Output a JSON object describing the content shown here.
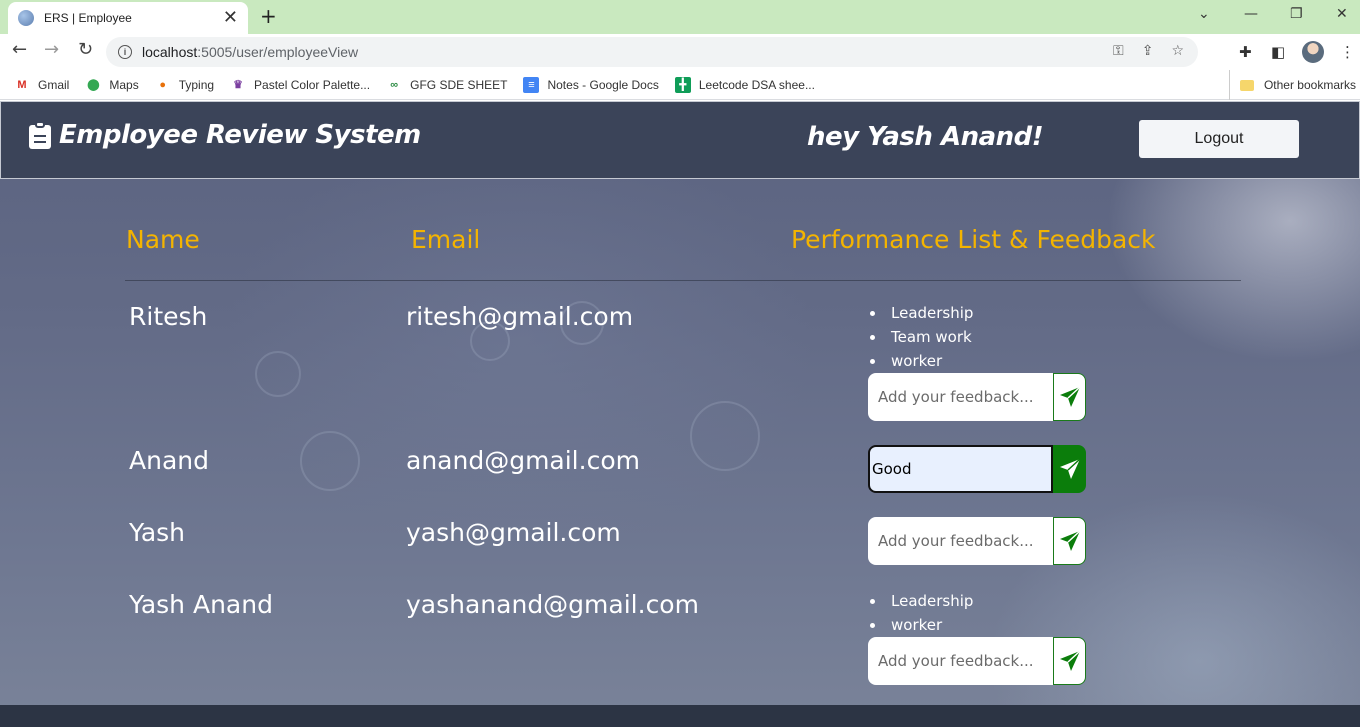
{
  "browser": {
    "tab_title": "ERS | Employee",
    "tab_close": "✕",
    "new_tab": "+",
    "url_host": "localhost",
    "url_rest": ":5005/user/employeeView",
    "bookmarks": [
      {
        "label": "Gmail",
        "icon": "gmail-icon",
        "color": "#d93025"
      },
      {
        "label": "Maps",
        "icon": "maps-icon",
        "color": "#34a853"
      },
      {
        "label": "Typing",
        "icon": "typing-icon",
        "color": "#e8710a"
      },
      {
        "label": "Pastel Color Palette...",
        "icon": "palette-icon",
        "color": "#7b3fa0"
      },
      {
        "label": "GFG SDE SHEET",
        "icon": "gfg-icon",
        "color": "#2f8d46"
      },
      {
        "label": "Notes - Google Docs",
        "icon": "docs-icon",
        "color": "#4285f4"
      },
      {
        "label": "Leetcode DSA shee...",
        "icon": "sheets-icon",
        "color": "#0f9d58"
      }
    ],
    "other_bookmarks": "Other bookmarks"
  },
  "navbar": {
    "brand": "Employee Review System",
    "greeting": "hey Yash Anand!",
    "logout_label": "Logout"
  },
  "table": {
    "headers": {
      "name": "Name",
      "email": "Email",
      "performance": "Performance List & Feedback"
    },
    "rows": [
      {
        "name": "Ritesh",
        "email": "ritesh@gmail.com",
        "performance": [
          "Leadership",
          "Team work",
          "worker"
        ],
        "feedback_value": "",
        "feedback_placeholder": "Add your feedback..."
      },
      {
        "name": "Anand",
        "email": "anand@gmail.com",
        "performance": [],
        "feedback_value": "Good",
        "feedback_placeholder": "Add your feedback..."
      },
      {
        "name": "Yash",
        "email": "yash@gmail.com",
        "performance": [],
        "feedback_value": "",
        "feedback_placeholder": "Add your feedback..."
      },
      {
        "name": "Yash Anand",
        "email": "yashanand@gmail.com",
        "performance": [
          "Leadership",
          "worker"
        ],
        "feedback_value": "",
        "feedback_placeholder": "Add your feedback..."
      }
    ]
  },
  "colors": {
    "accent_header": "#f4b400",
    "send_green": "#0b7d0b",
    "navbar_bg": "#3b4459"
  }
}
